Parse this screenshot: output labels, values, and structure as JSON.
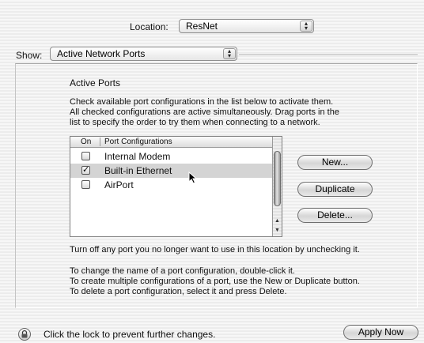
{
  "location": {
    "label": "Location:",
    "value": "ResNet"
  },
  "show": {
    "label": "Show:",
    "value": "Active Network Ports"
  },
  "section": {
    "title": "Active Ports",
    "instructions": [
      "Check available port configurations in the list below to activate them.",
      "All checked configurations are active simultaneously. Drag ports in the",
      "list to specify the order to try them when connecting to a network."
    ]
  },
  "port_list": {
    "columns": [
      "On",
      "Port Configurations"
    ],
    "rows": [
      {
        "name": "Internal Modem",
        "checked": false,
        "selected": false
      },
      {
        "name": "Built-in Ethernet",
        "checked": true,
        "selected": true
      },
      {
        "name": "AirPort",
        "checked": false,
        "selected": false
      }
    ]
  },
  "buttons": {
    "new": "New...",
    "duplicate": "Duplicate",
    "delete": "Delete...",
    "apply": "Apply Now"
  },
  "notes": {
    "turn_off": "Turn off any port you no longer want to use in this location by unchecking it.",
    "lines": [
      "To change the name of a port configuration, double-click it.",
      "To create multiple configurations of a port, use the New or Duplicate button.",
      "To delete a port configuration, select it and press Delete."
    ]
  },
  "lock_text": "Click the lock to prevent further changes.",
  "icons": {
    "popup_arrows": "up-down-arrows-icon",
    "lock": "lock-icon",
    "cursor": "arrow-cursor-icon",
    "check": "checkmark-icon"
  }
}
